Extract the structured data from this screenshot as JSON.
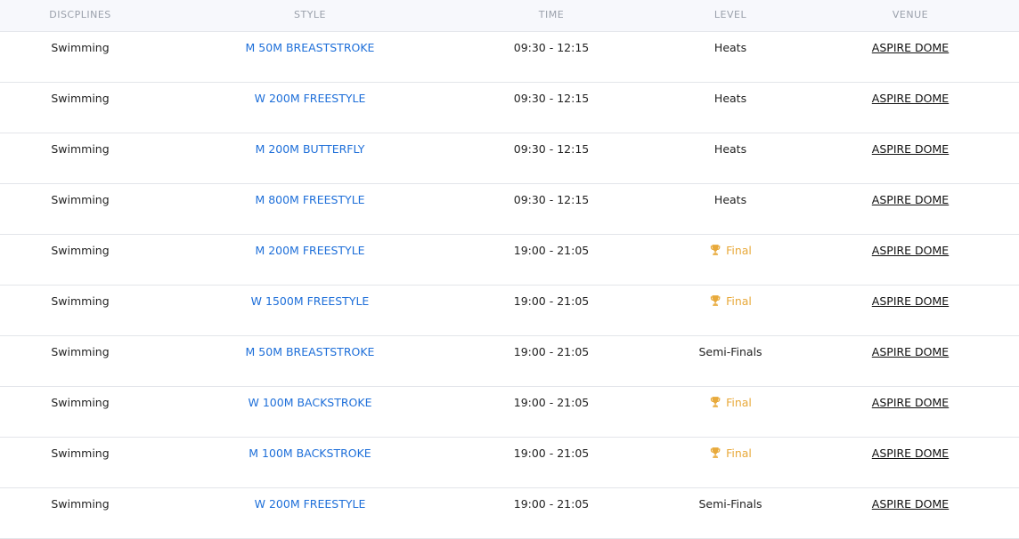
{
  "table": {
    "headers": {
      "discipline": "DISCPLINES",
      "style": "STYLE",
      "time": "TIME",
      "level": "LEVEL",
      "venue": "VENUE"
    },
    "rows": [
      {
        "discipline": "Swimming",
        "style": "M 50M BREASTSTROKE",
        "time": "09:30 - 12:15",
        "level": "Heats",
        "is_final": false,
        "venue": "ASPIRE DOME"
      },
      {
        "discipline": "Swimming",
        "style": "W 200M FREESTYLE",
        "time": "09:30 - 12:15",
        "level": "Heats",
        "is_final": false,
        "venue": "ASPIRE DOME"
      },
      {
        "discipline": "Swimming",
        "style": "M 200M BUTTERFLY",
        "time": "09:30 - 12:15",
        "level": "Heats",
        "is_final": false,
        "venue": "ASPIRE DOME"
      },
      {
        "discipline": "Swimming",
        "style": "M 800M FREESTYLE",
        "time": "09:30 - 12:15",
        "level": "Heats",
        "is_final": false,
        "venue": "ASPIRE DOME"
      },
      {
        "discipline": "Swimming",
        "style": "M 200M FREESTYLE",
        "time": "19:00 - 21:05",
        "level": "Final",
        "is_final": true,
        "venue": "ASPIRE DOME"
      },
      {
        "discipline": "Swimming",
        "style": "W 1500M FREESTYLE",
        "time": "19:00 - 21:05",
        "level": "Final",
        "is_final": true,
        "venue": "ASPIRE DOME"
      },
      {
        "discipline": "Swimming",
        "style": "M 50M BREASTSTROKE",
        "time": "19:00 - 21:05",
        "level": "Semi-Finals",
        "is_final": false,
        "venue": "ASPIRE DOME"
      },
      {
        "discipline": "Swimming",
        "style": "W 100M BACKSTROKE",
        "time": "19:00 - 21:05",
        "level": "Final",
        "is_final": true,
        "venue": "ASPIRE DOME"
      },
      {
        "discipline": "Swimming",
        "style": "M 100M BACKSTROKE",
        "time": "19:00 - 21:05",
        "level": "Final",
        "is_final": true,
        "venue": "ASPIRE DOME"
      },
      {
        "discipline": "Swimming",
        "style": "W 200M FREESTYLE",
        "time": "19:00 - 21:05",
        "level": "Semi-Finals",
        "is_final": false,
        "venue": "ASPIRE DOME"
      }
    ]
  },
  "icons": {
    "final": "trophy-icon"
  },
  "colors": {
    "style_link": "#1e6fd9",
    "final_level": "#e8a93a",
    "header_text": "#9aa0ab",
    "header_bg": "#f7f8fc"
  }
}
